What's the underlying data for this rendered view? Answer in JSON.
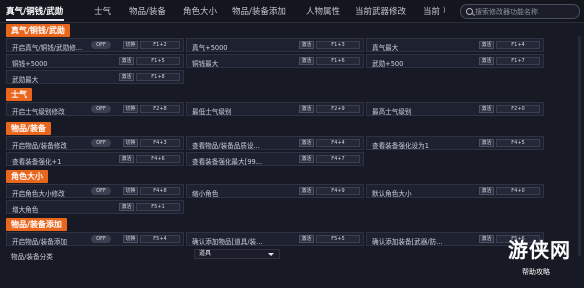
{
  "tabs": [
    "真气/铜钱/武勋",
    "士气",
    "物品/装备",
    "角色大小",
    "物品/装备添加",
    "人物属性",
    "当前武器修改",
    "当前"
  ],
  "search": {
    "placeholder": "搜索修改器功能名称"
  },
  "labels": {
    "on": "激活",
    "off": "OFF",
    "toggle": "切换"
  },
  "sections": [
    {
      "title": "真气/铜钱/武勋",
      "rows": [
        [
          {
            "label": "开启真气/铜钱/武勋修...",
            "toggle": true,
            "keys": [
              "F1+2"
            ]
          },
          {
            "label": "真气+5000",
            "toggle": false,
            "keys": [
              "F1+3"
            ]
          },
          {
            "label": "真气最大",
            "toggle": false,
            "keys": [
              "F1+4"
            ]
          }
        ],
        [
          {
            "label": "铜钱+5000",
            "toggle": false,
            "keys": [
              "F1+5"
            ]
          },
          {
            "label": "铜钱最大",
            "toggle": false,
            "keys": [
              "F1+6"
            ]
          },
          {
            "label": "武勋+500",
            "toggle": false,
            "keys": [
              "F1+7"
            ]
          }
        ],
        [
          {
            "label": "武勋最大",
            "toggle": false,
            "keys": [
              "F1+8"
            ]
          }
        ]
      ]
    },
    {
      "title": "士气",
      "rows": [
        [
          {
            "label": "开启士气级别修改",
            "toggle": true,
            "keys": [
              "F2+8"
            ]
          },
          {
            "label": "最低士气级别",
            "toggle": false,
            "keys": [
              "F2+9"
            ]
          },
          {
            "label": "最高士气级别",
            "toggle": false,
            "keys": [
              "F2+0"
            ]
          }
        ]
      ]
    },
    {
      "title": "物品/装备",
      "rows": [
        [
          {
            "label": "开启物品/装备修改",
            "toggle": true,
            "keys": [
              "F4+3"
            ]
          },
          {
            "label": "查看物品/装备品质设...",
            "toggle": false,
            "keys": [
              "F4+4"
            ]
          },
          {
            "label": "查看装备强化设为1",
            "toggle": false,
            "keys": [
              "F4+5"
            ]
          }
        ],
        [
          {
            "label": "查看装备强化+1",
            "toggle": false,
            "keys": [
              "F4+6"
            ]
          },
          {
            "label": "查看装备强化最大[99...",
            "toggle": false,
            "keys": [
              "F4+7"
            ]
          }
        ]
      ]
    },
    {
      "title": "角色大小",
      "rows": [
        [
          {
            "label": "开启角色大小修改",
            "toggle": true,
            "keys": [
              "F4+8"
            ]
          },
          {
            "label": "缩小角色",
            "toggle": false,
            "keys": [
              "F4+9"
            ]
          },
          {
            "label": "默认角色大小",
            "toggle": false,
            "keys": [
              "F4+0"
            ]
          }
        ],
        [
          {
            "label": "增大角色",
            "toggle": false,
            "keys": [
              "F5+1"
            ]
          }
        ]
      ]
    },
    {
      "title": "物品/装备添加",
      "rows": [
        [
          {
            "label": "开启物品/装备添加",
            "toggle": true,
            "keys": [
              "F5+4"
            ]
          },
          {
            "label": "确认添加物品[道具/装...",
            "toggle": false,
            "keys": [
              "F5+5"
            ]
          },
          {
            "label": "确认添加装备[武器/防...",
            "toggle": false,
            "keys": [
              "F5+6"
            ]
          }
        ],
        [
          {
            "label": "物品/装备分类",
            "select": "道具"
          }
        ]
      ]
    }
  ],
  "watermark": {
    "title": "游侠网",
    "subtitle": "帮助攻略"
  },
  "colors": {
    "accent": "#e9661d",
    "background": "#171a24"
  }
}
